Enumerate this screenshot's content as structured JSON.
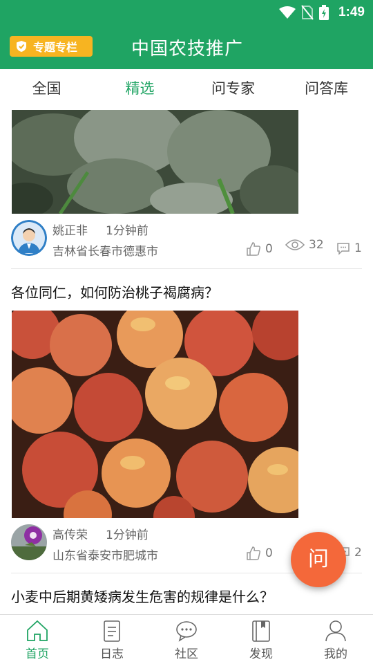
{
  "status_bar": {
    "time": "1:49"
  },
  "app_bar": {
    "topic_badge": "专题专栏",
    "title": "中国农技推广"
  },
  "tabs": [
    {
      "label": "全国",
      "active": false
    },
    {
      "label": "精选",
      "active": true
    },
    {
      "label": "问专家",
      "active": false
    },
    {
      "label": "问答库",
      "active": false
    }
  ],
  "posts": [
    {
      "image": "leaves-photo",
      "author": "姚正非",
      "time": "1分钟前",
      "location": "吉林省长春市德惠市",
      "likes": "0",
      "views": "32",
      "comments": "1"
    },
    {
      "title": "各位同仁，如何防治桃子褐腐病？",
      "image": "peaches-photo",
      "author": "高传荣",
      "time": "1分钟前",
      "location": "山东省泰安市肥城市",
      "likes": "0",
      "comments": "2"
    },
    {
      "title": "小麦中后期黄矮病发生危害的规律是什么？"
    }
  ],
  "fab": {
    "label": "问"
  },
  "bottom_nav": [
    {
      "label": "首页",
      "icon": "home-icon",
      "active": true
    },
    {
      "label": "日志",
      "icon": "log-icon",
      "active": false
    },
    {
      "label": "社区",
      "icon": "chat-icon",
      "active": false
    },
    {
      "label": "发现",
      "icon": "book-icon",
      "active": false
    },
    {
      "label": "我的",
      "icon": "user-icon",
      "active": false
    }
  ],
  "colors": {
    "primary": "#1fa463",
    "badge": "#f7b421",
    "fab": "#f4683a"
  }
}
